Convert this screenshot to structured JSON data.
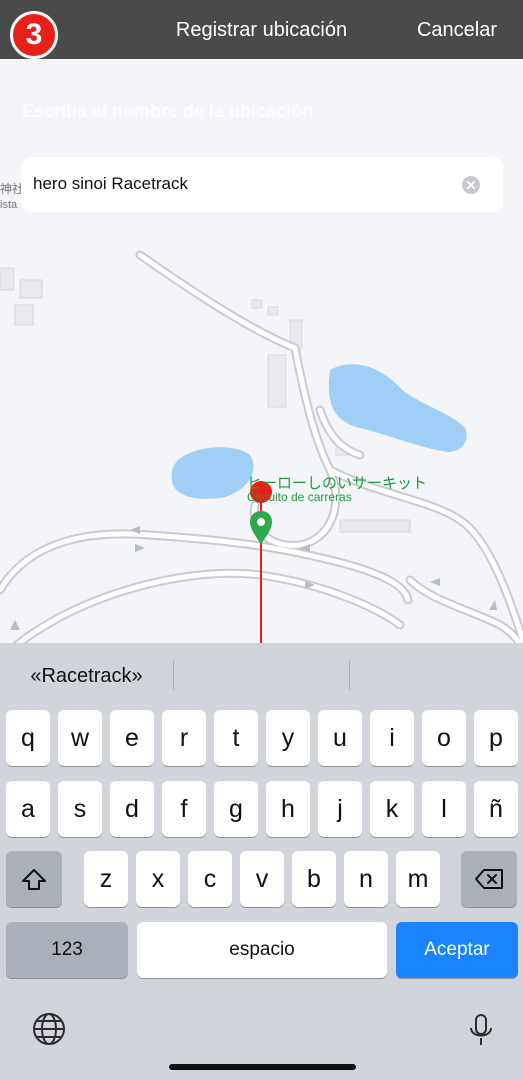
{
  "step_number": "3",
  "navbar": {
    "title": "Registrar ubicación",
    "cancel_label": "Cancelar"
  },
  "search": {
    "hint": "Escriba el nombre de la ubicación",
    "value": "hero sinoi Racetrack"
  },
  "map": {
    "place_name_jp": "ヒーローしのいサーキット",
    "place_name_es": "Circuito de carreras",
    "left_label_1": "神社",
    "left_label_2": "ista"
  },
  "keyboard": {
    "suggestion": "«Racetrack»",
    "row1": [
      "q",
      "w",
      "e",
      "r",
      "t",
      "y",
      "u",
      "i",
      "o",
      "p"
    ],
    "row2": [
      "a",
      "s",
      "d",
      "f",
      "g",
      "h",
      "j",
      "k",
      "l",
      "ñ"
    ],
    "row3": [
      "z",
      "x",
      "c",
      "v",
      "b",
      "n",
      "m"
    ],
    "numbers_label": "123",
    "space_label": "espacio",
    "return_label": "Aceptar"
  },
  "colors": {
    "marker_red": "#e8201a",
    "pin_green": "#2fa84f",
    "return_blue": "#1a84ff",
    "water": "#9fcff6"
  }
}
